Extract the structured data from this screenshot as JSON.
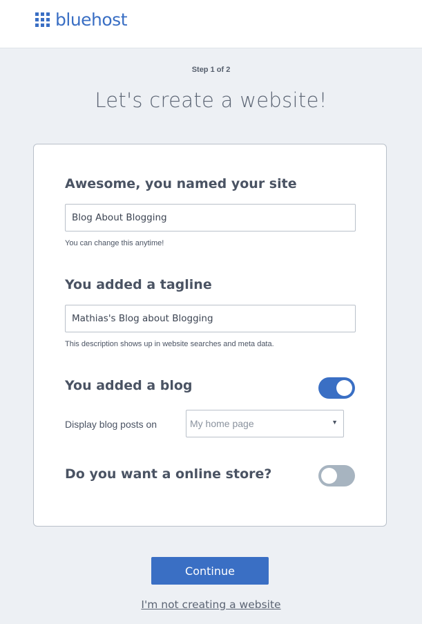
{
  "header": {
    "brand_name": "bluehost",
    "logo_icon": "grid-icon",
    "brand_color": "#3a6fc4"
  },
  "step_indicator": "Step 1 of 2",
  "page_title": "Let's create a website!",
  "form": {
    "site_name": {
      "heading": "Awesome, you named your site",
      "value": "Blog About Blogging",
      "hint": "You can change this anytime!"
    },
    "tagline": {
      "heading": "You added a tagline",
      "value": "Mathias's Blog about Blogging",
      "hint": "This description shows up in website searches and meta data."
    },
    "blog": {
      "heading": "You added a blog",
      "toggle_on": true,
      "display_label": "Display blog posts on",
      "display_select_value": "My home page"
    },
    "online_store": {
      "heading": "Do you want a online store?",
      "toggle_on": false
    }
  },
  "actions": {
    "continue_label": "Continue",
    "not_creating_label": "I'm not creating a website"
  }
}
